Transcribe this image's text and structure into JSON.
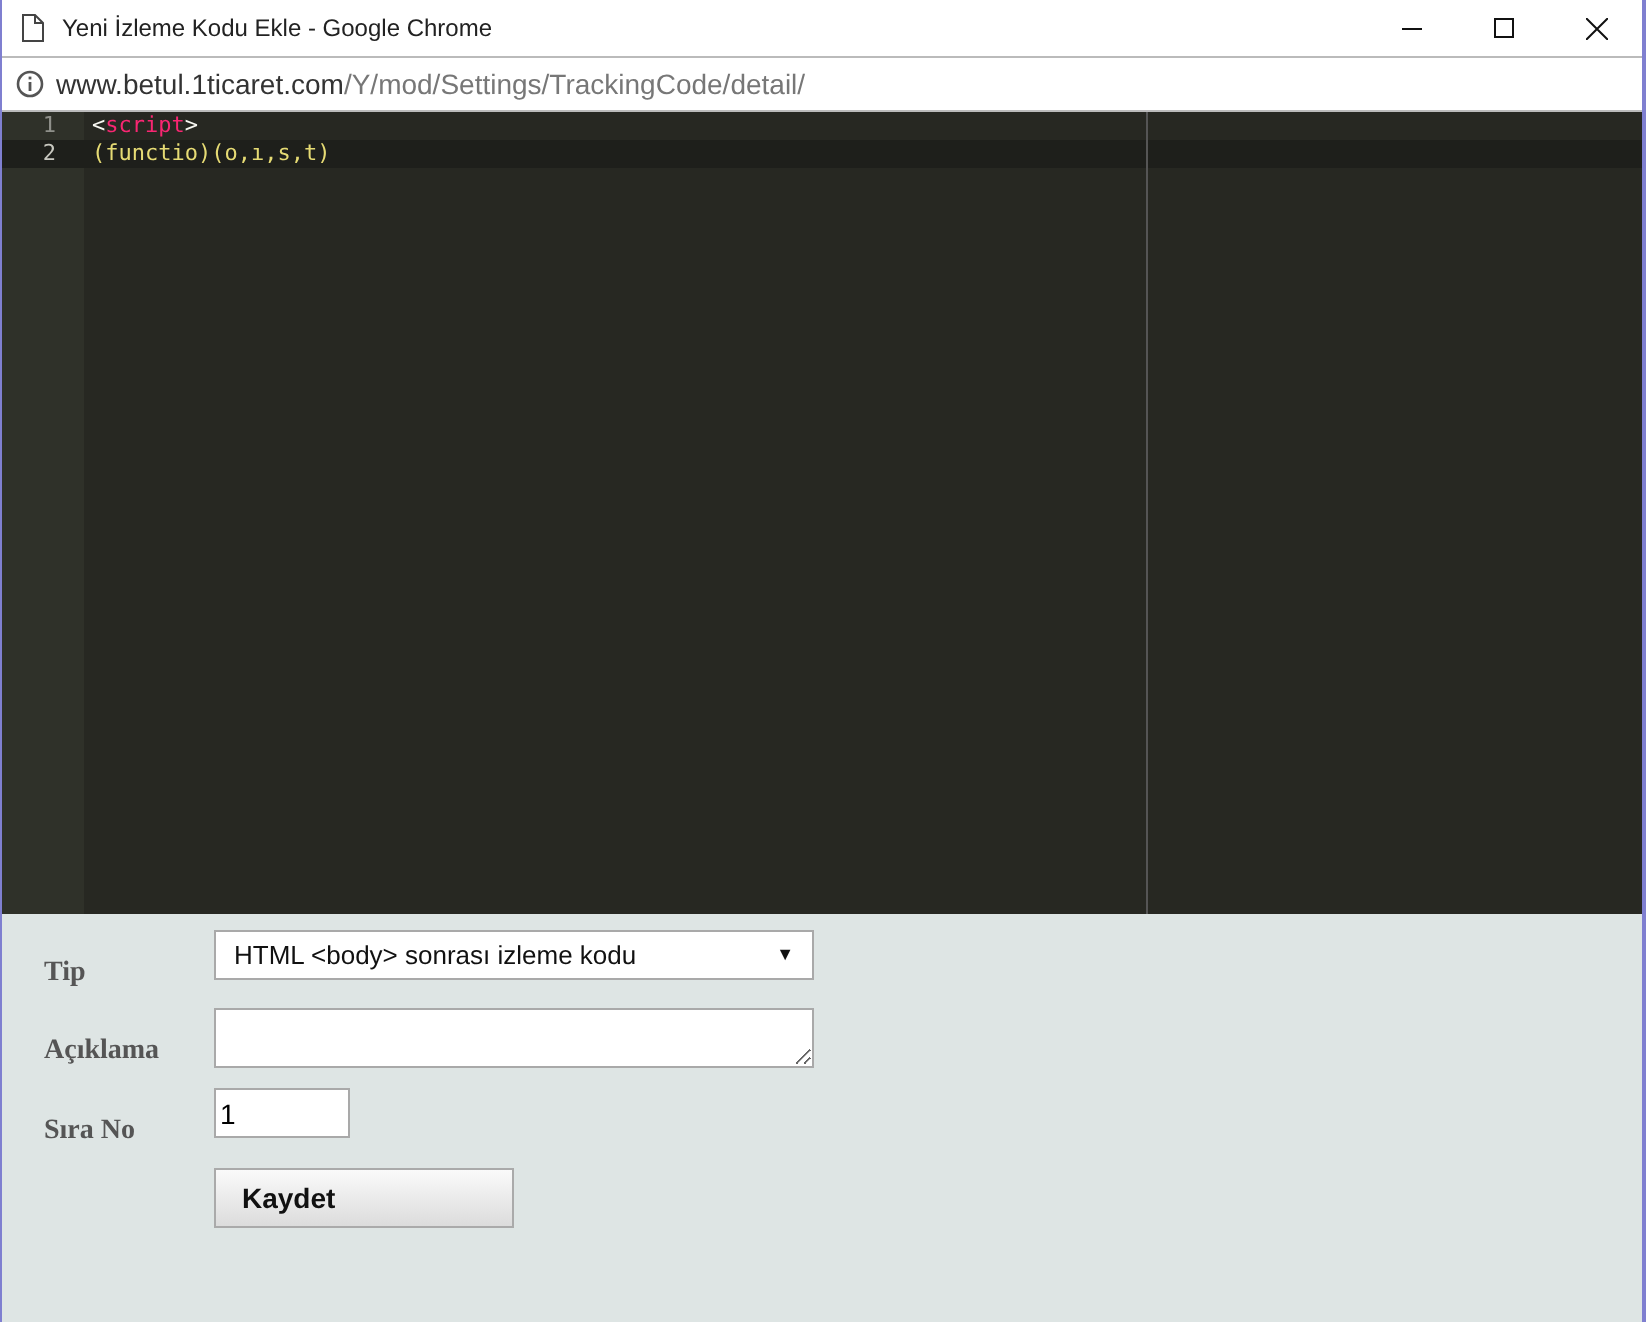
{
  "window": {
    "title": "Yeni İzleme Kodu Ekle - Google Chrome"
  },
  "address_bar": {
    "host": "www.betul.1ticaret.com",
    "path": "/Y/mod/Settings/TrackingCode/detail/"
  },
  "editor": {
    "lines": [
      {
        "number": "1",
        "active": false,
        "tokens": [
          {
            "text": "<",
            "kind": "punct"
          },
          {
            "text": "script",
            "kind": "tag"
          },
          {
            "text": ">",
            "kind": "punct"
          }
        ]
      },
      {
        "number": "2",
        "active": true,
        "tokens": [
          {
            "text": "(functio)(o,ı,s,t)",
            "kind": "plain"
          }
        ]
      }
    ]
  },
  "form": {
    "fields": [
      {
        "label": "Tip",
        "kind": "select",
        "value": "HTML <body> sonrası izleme kodu",
        "arrow": "▼"
      },
      {
        "label": "Açıklama",
        "kind": "textarea"
      },
      {
        "label": "Sıra No",
        "kind": "input",
        "value": "1"
      }
    ],
    "submit": "Kaydet"
  }
}
